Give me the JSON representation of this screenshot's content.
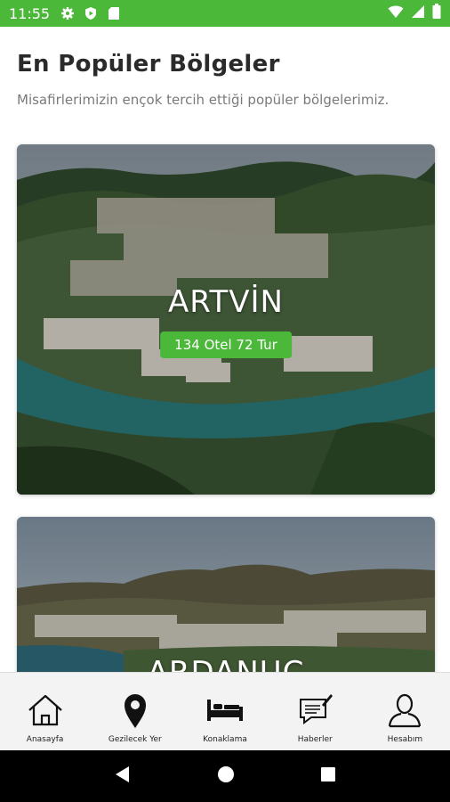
{
  "status_bar": {
    "time": "11:55",
    "background": "#4cb83a",
    "left_icons": [
      "settings-icon",
      "play-protect-icon",
      "sd-card-icon"
    ],
    "right_icons": [
      "wifi-icon",
      "signal-icon",
      "battery-icon"
    ]
  },
  "header": {
    "title": "En Popüler Bölgeler",
    "subtitle": "Misafirlerimizin ençok tercih ettiği popüler bölgelerimiz."
  },
  "regions": [
    {
      "name": "ARTVİN",
      "badge": "134 Otel 72 Tur"
    },
    {
      "name": "ARDANUÇ"
    }
  ],
  "bottom_nav": {
    "items": [
      {
        "label": "Anasayfa",
        "icon": "home-icon"
      },
      {
        "label": "Gezilecek Yer",
        "icon": "map-pin-icon"
      },
      {
        "label": "Konaklama",
        "icon": "bed-icon"
      },
      {
        "label": "Haberler",
        "icon": "news-icon"
      },
      {
        "label": "Hesabım",
        "icon": "user-icon"
      }
    ]
  },
  "colors": {
    "accent": "#4cb83a",
    "nav_background": "#f3f3f3"
  }
}
